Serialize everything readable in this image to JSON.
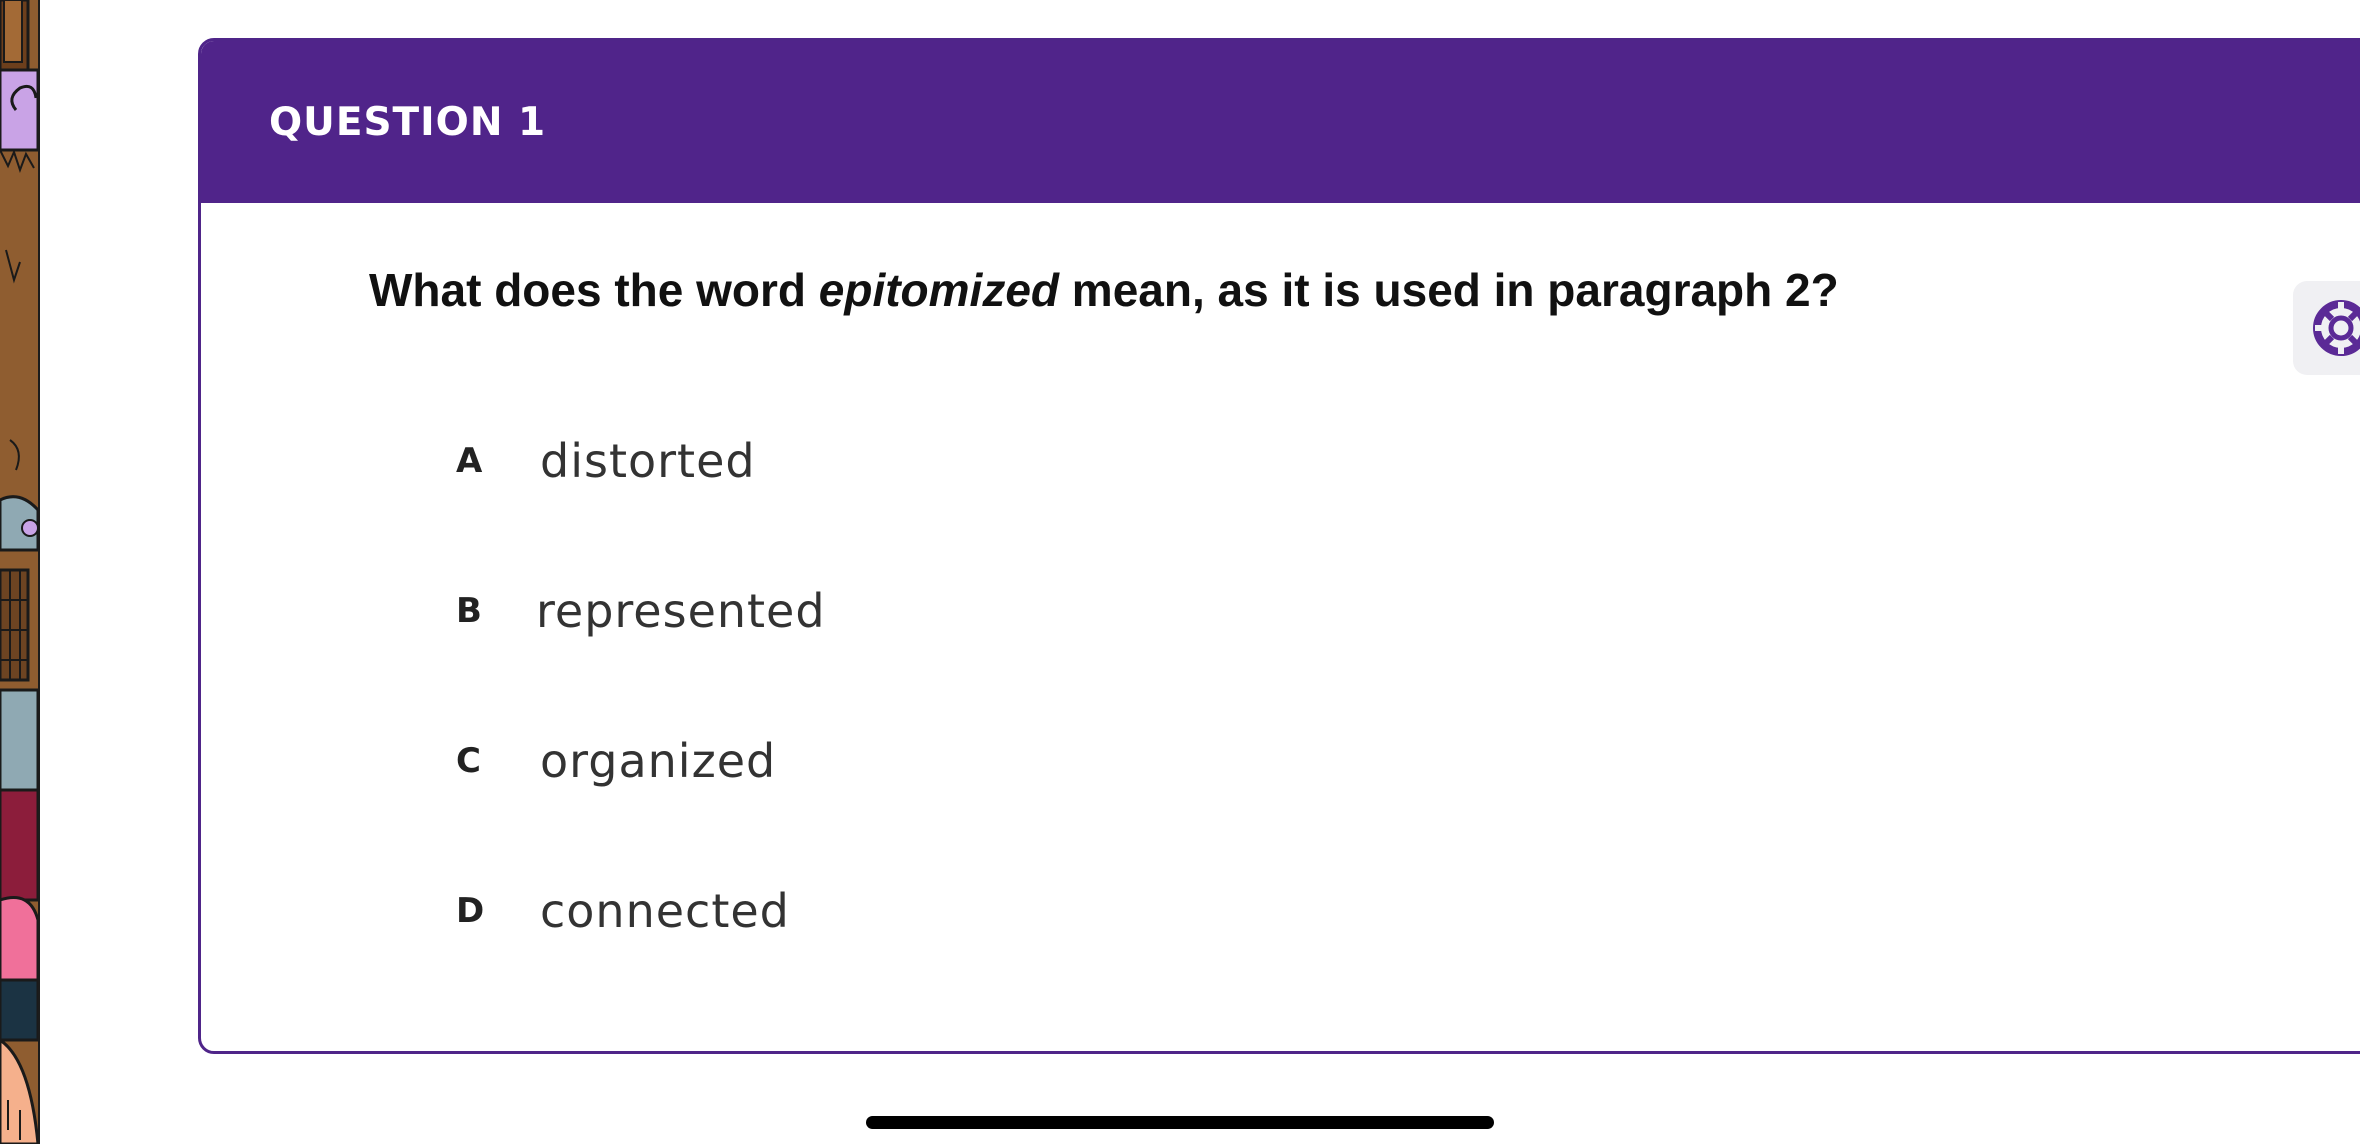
{
  "question": {
    "header_label": "QUESTION 1",
    "stem_before": "What does the word ",
    "stem_keyword": "epitomized",
    "stem_after": " mean, as it is used in paragraph 2?",
    "choices": [
      {
        "letter": "A",
        "text": "distorted"
      },
      {
        "letter": "B",
        "text": "represented"
      },
      {
        "letter": "C",
        "text": "organized"
      },
      {
        "letter": "D",
        "text": "connected"
      }
    ]
  },
  "help_tab": {
    "icon": "lifebuoy-icon"
  },
  "colors": {
    "header_purple": "#50248a",
    "card_border": "#4f2589",
    "help_icon": "#5b2a96"
  }
}
